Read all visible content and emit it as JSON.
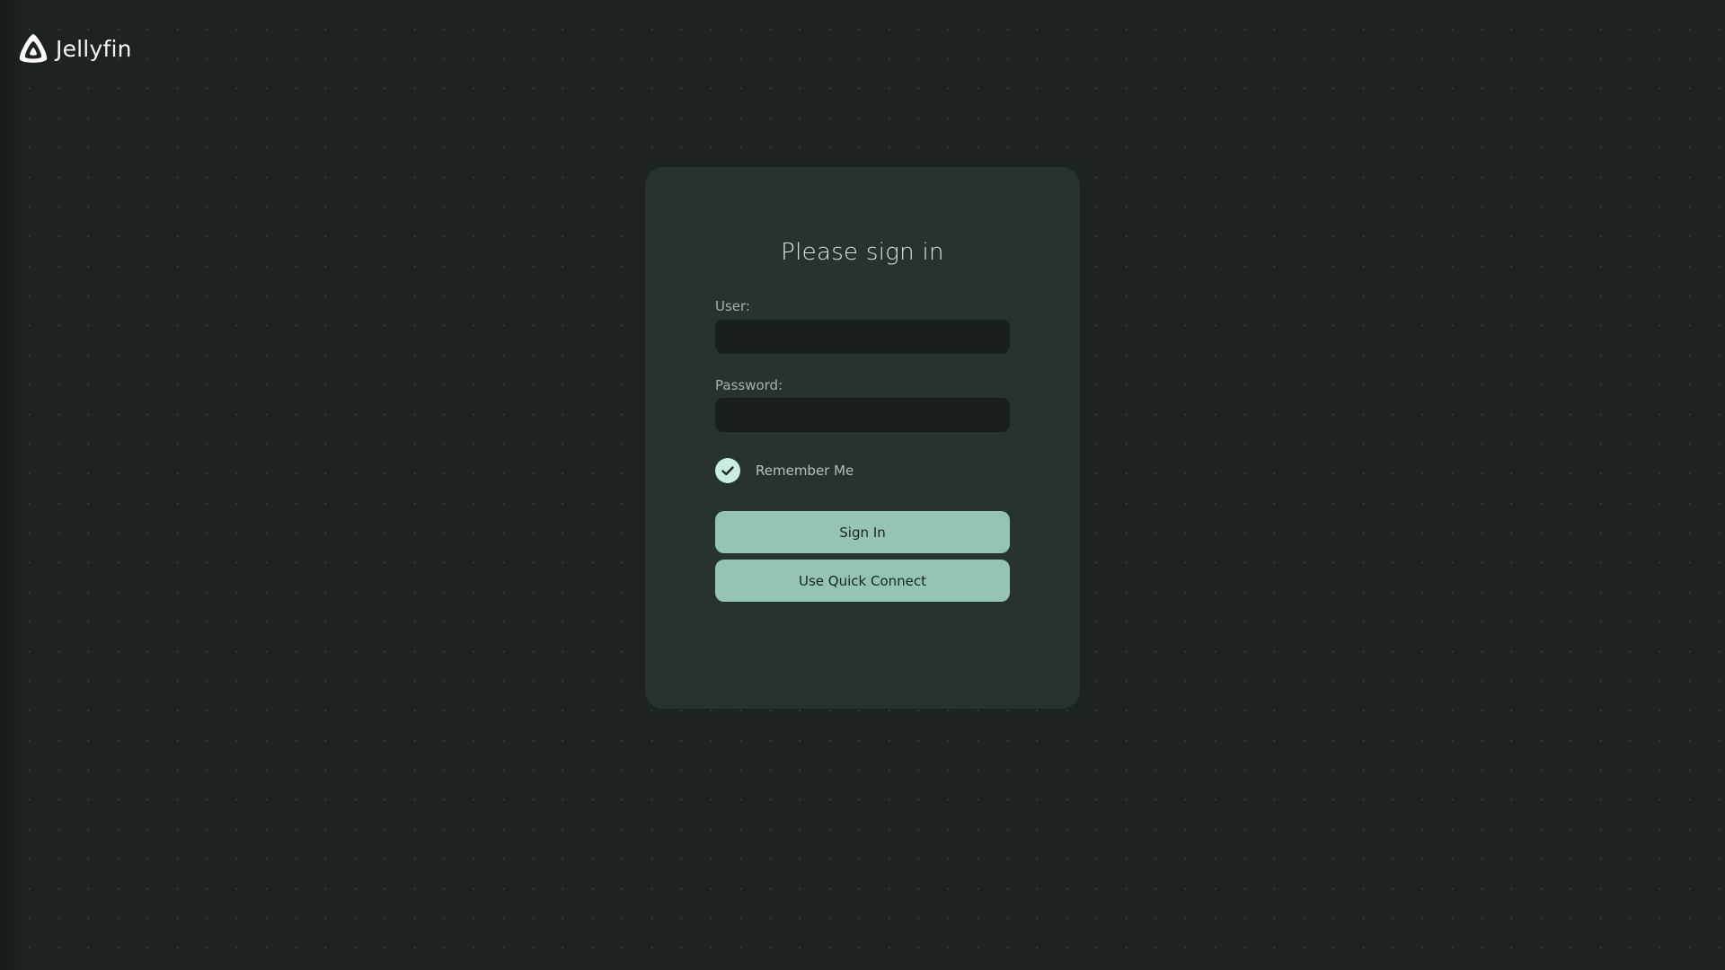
{
  "app": {
    "brand_name": "Jellyfin",
    "logo_icon": "jellyfin-logo-icon"
  },
  "login": {
    "title": "Please sign in",
    "user_label": "User:",
    "user_value": "",
    "password_label": "Password:",
    "password_value": "",
    "remember_label": "Remember Me",
    "remember_checked": true,
    "sign_in_label": "Sign In",
    "quick_connect_label": "Use Quick Connect"
  },
  "colors": {
    "background": "#1c2322",
    "card": "#283331",
    "input": "#1a1f1e",
    "accent": "#94c4b2",
    "check": "#c8eee0"
  }
}
